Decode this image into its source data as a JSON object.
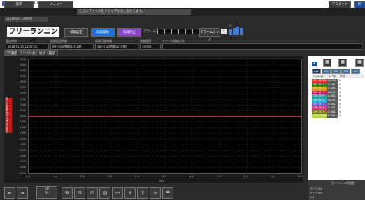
{
  "window": {
    "title": "GL2B-APS Ver 1.01"
  },
  "menu": {
    "file": "操作",
    "menu": "メニュー",
    "help_text": "ここにファイルをドロップすると再生します。",
    "right1": "プロダクト",
    "right2": "終"
  },
  "subtab": "GL2B(23718965)",
  "toolbar": {
    "mode": "フリーランニング",
    "btn1": "収録設定",
    "btn2": "収録開始",
    "btn3": "収録停止",
    "alarm_label": "アラーム",
    "alarm_clear_label": "アラームクリア",
    "alarm_clear_value": "1",
    "level_label": "IO"
  },
  "status": {
    "start_label": "開始時刻",
    "start_value": "2018/11/15 13:57:31",
    "elapsed_label": "収録経過時間",
    "elapsed_value": "00日 00時間01分16秒",
    "remain_label": "収録可能時間",
    "remain_value": "365日 23時間52分 8秒",
    "interval_label": "測定間隔",
    "interval_value": "100ms",
    "file_label": "ファイル格納先名",
    "file_value": ""
  },
  "tabs": [
    "Y-T表示",
    "デジタル表示",
    "統計・履歴"
  ],
  "chart_data": {
    "type": "line",
    "y_ticks": [
      "5.00",
      "4.50",
      "4.00",
      "3.50",
      "3.00",
      "2.50",
      "2.00",
      "1.50",
      "1.00",
      "0.50",
      "0.00",
      "-0.50",
      "-1.00",
      "-1.50",
      "-2.00",
      "-2.50",
      "-3.00",
      "-3.50",
      "-4.00",
      "-4.50",
      "-5.00"
    ],
    "x_ticks": [
      "0.0",
      "1.0",
      "2.0",
      "3.0",
      "4.0",
      "5.0",
      "6.0",
      "7.0",
      "8.0",
      "9.0",
      "10.0"
    ],
    "xlabel": "Sec",
    "ylabel": "CH4[GL2B(23718965)],CH4",
    "ylim": [
      -5,
      5
    ],
    "xlim": [
      0,
      10
    ],
    "series": [
      {
        "name": "CH4",
        "color": "#e0404a",
        "values": [
          0.0,
          0.0
        ]
      }
    ]
  },
  "right_panel": {
    "group_tabs": [
      "ALL",
      "G1",
      "G2",
      "G3",
      "G4"
    ],
    "col_ch": "CH(ALL)",
    "col_val": "レベル",
    "col_unit": "単位",
    "channels": [
      {
        "name": "CH1 SENSOR(CH1)",
        "value": "+0.000",
        "unit": "V",
        "color": "#d33"
      },
      {
        "name": "CH2 CH 2",
        "value": "-0.001",
        "unit": "V",
        "color": "#2a8a2a"
      },
      {
        "name": "CH3 CH 3",
        "value": "-0.001",
        "unit": "V",
        "color": "#d5a000"
      },
      {
        "name": "CH4 CH 4",
        "value": "+0.001",
        "unit": "V",
        "color": "#d11b6b"
      },
      {
        "name": "CH5 CH 5",
        "value": "-0.001",
        "unit": "V",
        "color": "#27a3a3"
      },
      {
        "name": "CH6 CH 6",
        "value": "+0.001",
        "unit": "V",
        "color": "#2bb2d0"
      },
      {
        "name": "CH7 CH 7",
        "value": "-0.001",
        "unit": "V",
        "color": "#6a5acd"
      },
      {
        "name": "CH8 CH 8",
        "value": "-0.001",
        "unit": "V",
        "color": "#d63a8a"
      },
      {
        "name": "CH9 CH 9",
        "value": "-0.001",
        "unit": "V",
        "color": "#7a7a00"
      },
      {
        "name": "CH10 CH10",
        "value": "-0.001",
        "unit": "V",
        "color": "#b2d84a"
      }
    ],
    "cursor_title": "カーソル1/2時間差",
    "cursor_rows": [
      "カーソルA",
      "カーソルB",
      "A-B"
    ]
  },
  "bottom": {
    "zoom_label": "5秒",
    "zoom_value": "5s"
  }
}
